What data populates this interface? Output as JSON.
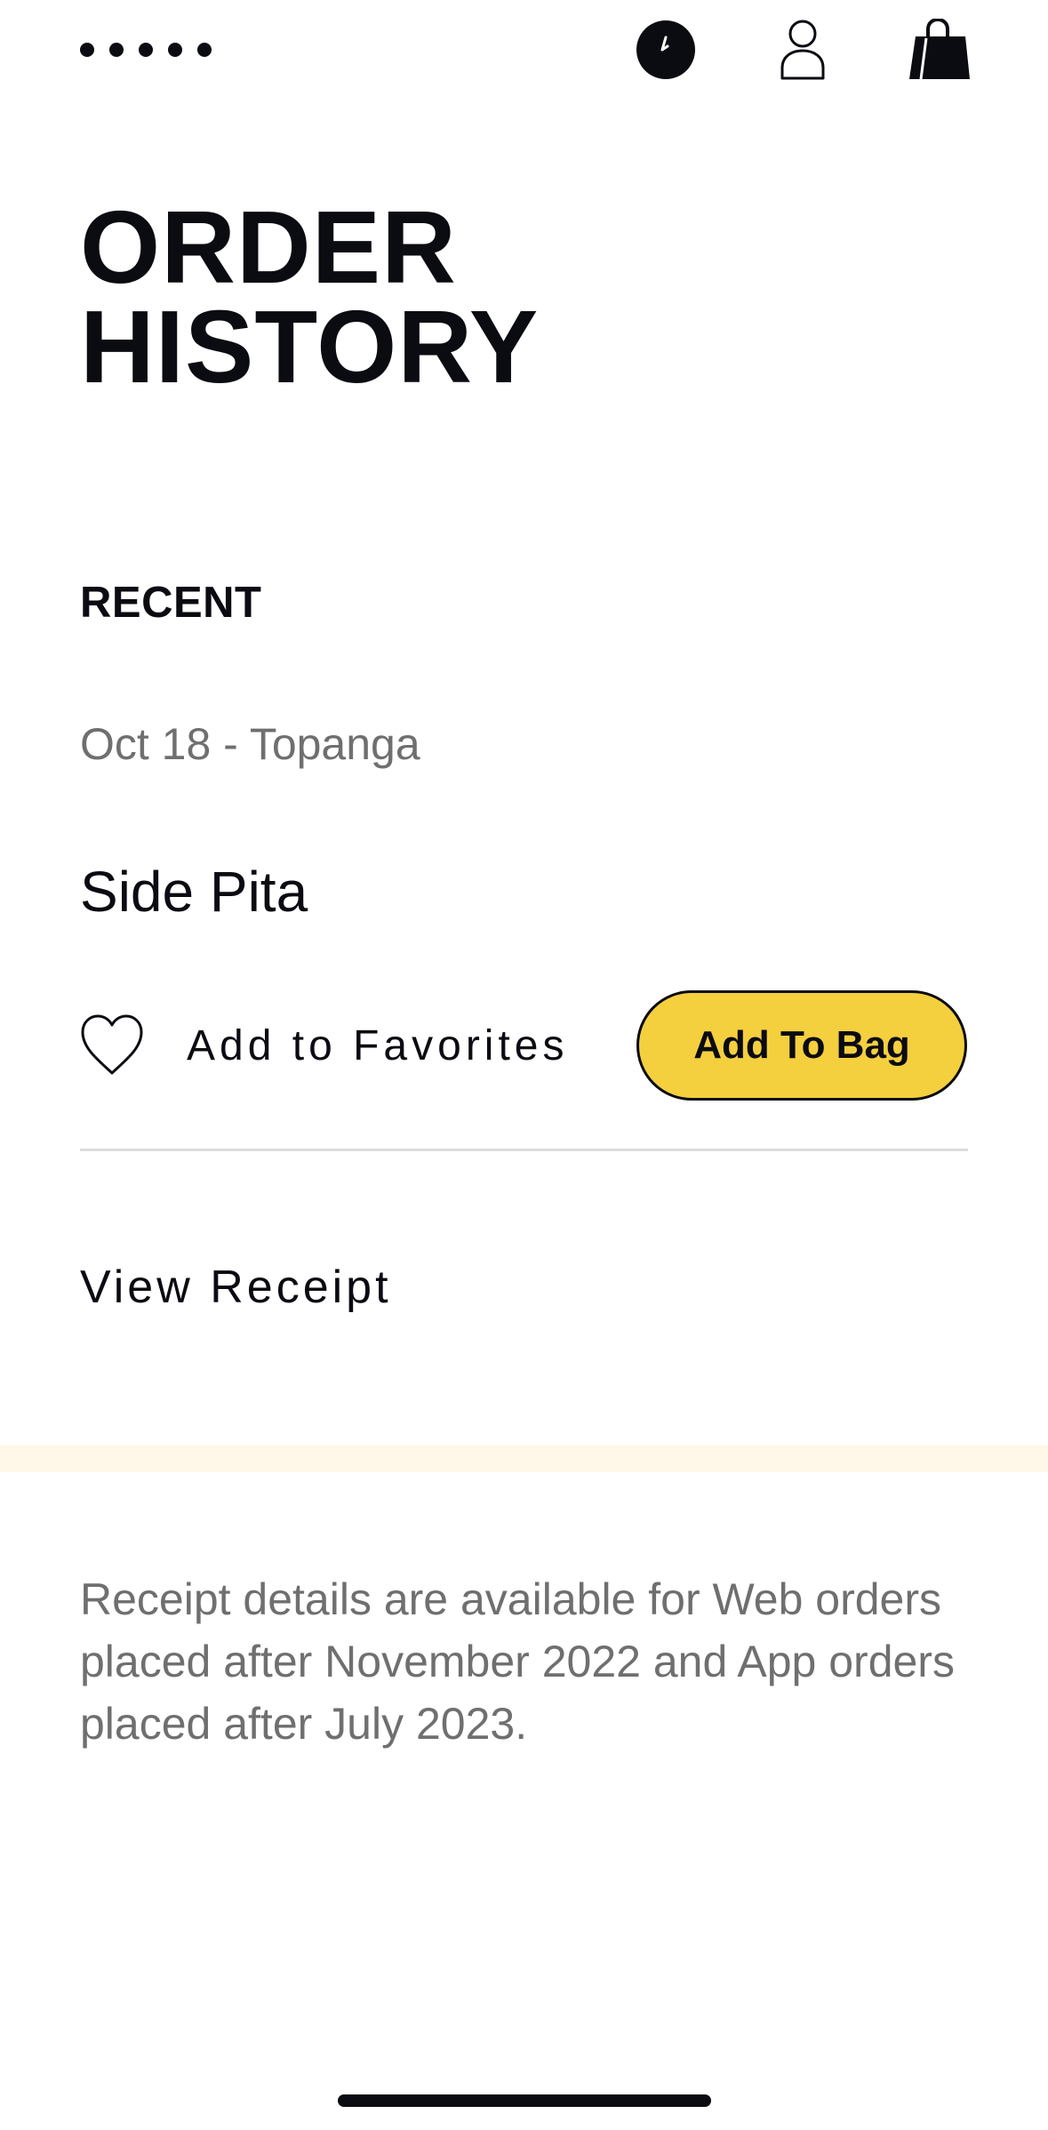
{
  "nav": {
    "menu_icon": "dots-menu-icon",
    "clock_icon": "clock-icon",
    "user_icon": "user-icon",
    "bag_icon": "shopping-bag-icon"
  },
  "page": {
    "title_line1": "ORDER",
    "title_line2": "HISTORY"
  },
  "recent": {
    "section_label": "RECENT",
    "order": {
      "meta": "Oct 18 - Topanga",
      "item_name": "Side Pita",
      "favorite_label": "Add to Favorites",
      "favorite_icon": "heart-icon",
      "add_to_bag_label": "Add To Bag",
      "view_receipt_label": "View Receipt"
    }
  },
  "note": {
    "text": "Receipt details are available for Web orders placed after November 2022 and App orders placed after July 2023."
  },
  "colors": {
    "accent_yellow": "#f4cf3e",
    "text_dark": "#0b0b12",
    "text_muted": "#6f6f6f",
    "divider": "#dcdcdc",
    "band": "#fff8e8"
  }
}
